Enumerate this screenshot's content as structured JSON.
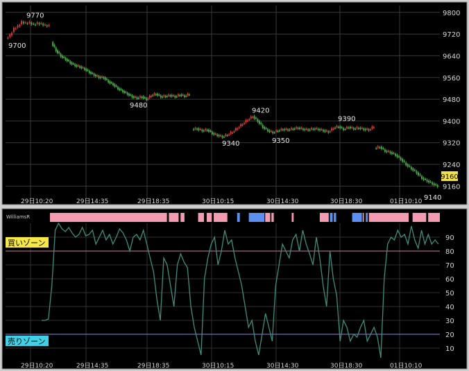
{
  "chart_data": [
    {
      "type": "candlestick",
      "y_ticks": [
        "9800",
        "9720",
        "9640",
        "9560",
        "9480",
        "9400",
        "9320",
        "9240",
        "9160"
      ],
      "ylim": [
        9115,
        9825
      ],
      "x_tick_labels": [
        "29日10:20",
        "29日14:35",
        "29日18:35",
        "30日10:15",
        "30日14:30",
        "30日18:30",
        "01日10:10"
      ],
      "last_price_label": "9160",
      "annotations": [
        {
          "text": "9770",
          "value": 9770
        },
        {
          "text": "9700",
          "value": 9700
        },
        {
          "text": "9480",
          "value": 9480
        },
        {
          "text": "9420",
          "value": 9420
        },
        {
          "text": "9390",
          "value": 9390
        },
        {
          "text": "9340",
          "value": 9340
        },
        {
          "text": "9350",
          "value": 9350
        },
        {
          "text": "9140",
          "value": 9140
        }
      ],
      "series": [
        {
          "segment": 1,
          "path": [
            9705,
            9715,
            9740,
            9748,
            9765,
            9760,
            9762,
            9755,
            9760,
            9758,
            9752,
            9750
          ]
        },
        {
          "segment": 2,
          "path": [
            9690,
            9660,
            9640,
            9628,
            9615,
            9605,
            9600,
            9592,
            9580,
            9570,
            9562,
            9560,
            9545,
            9535,
            9520,
            9510,
            9500,
            9490,
            9485,
            9490,
            9480,
            9495,
            9500,
            9490,
            9492,
            9495,
            9490,
            9497,
            9492,
            9500
          ]
        },
        {
          "segment": 3,
          "path": [
            9370,
            9372,
            9365,
            9368,
            9355,
            9348,
            9342,
            9350,
            9360,
            9375,
            9390,
            9405,
            9418,
            9400,
            9378,
            9365,
            9358,
            9365,
            9370,
            9368,
            9372,
            9375,
            9370,
            9368,
            9372,
            9370,
            9365,
            9360,
            9375,
            9380,
            9370,
            9378,
            9372,
            9375,
            9370,
            9368,
            9380
          ]
        },
        {
          "segment": 4,
          "path": [
            9300,
            9305,
            9290,
            9285,
            9275,
            9260,
            9240,
            9225,
            9210,
            9190,
            9180,
            9170,
            9160
          ]
        }
      ]
    },
    {
      "type": "line",
      "indicator_label": "WilliamsR",
      "y_ticks": [
        "90",
        "80",
        "70",
        "60",
        "50",
        "40",
        "30",
        "20",
        "10"
      ],
      "ylim": [
        0,
        100
      ],
      "buy_zone_label": "買いゾーン",
      "sell_zone_label": "売りゾーン",
      "buy_zone_value": 80,
      "sell_zone_value": 20,
      "series": [
        {
          "values": [
            30,
            30,
            31,
            55,
            95,
            100,
            96,
            94,
            97,
            93,
            90,
            92,
            97,
            91,
            92,
            95,
            85,
            90,
            95,
            88,
            92,
            85,
            90,
            96,
            93,
            88,
            80,
            90,
            92,
            88,
            95,
            85,
            75,
            65,
            45,
            30,
            75,
            70,
            55,
            40,
            70,
            78,
            72,
            68,
            40,
            25,
            15,
            5,
            60,
            75,
            85,
            90,
            70,
            80,
            95,
            85,
            88,
            75,
            65,
            55,
            40,
            25,
            30,
            15,
            5,
            20,
            35,
            25,
            15,
            55,
            70,
            85,
            80,
            75,
            88,
            92,
            80,
            95,
            85,
            78,
            70,
            90,
            75,
            55,
            40,
            80,
            60,
            48,
            15,
            30,
            25,
            15,
            20,
            18,
            25,
            30,
            15,
            20,
            25,
            18,
            3,
            60,
            85,
            90,
            88,
            95,
            90,
            92,
            85,
            98,
            88,
            82,
            95,
            85,
            92,
            85,
            88,
            85
          ]
        }
      ],
      "zone_bar": [
        {
          "color": "#f39bb0",
          "from": 0,
          "to": 0.3
        },
        {
          "color": "#f39bb0",
          "from": 0.305,
          "to": 0.33
        },
        {
          "color": "#f39bb0",
          "from": 0.335,
          "to": 0.345
        },
        {
          "color": "#f39bb0",
          "from": 0.38,
          "to": 0.395
        },
        {
          "color": "#f39bb0",
          "from": 0.402,
          "to": 0.415
        },
        {
          "color": "#f39bb0",
          "from": 0.42,
          "to": 0.455
        },
        {
          "color": "#5b8ff0",
          "from": 0.48,
          "to": 0.487
        },
        {
          "color": "#5b8ff0",
          "from": 0.51,
          "to": 0.55
        },
        {
          "color": "#f39bb0",
          "from": 0.552,
          "to": 0.565
        },
        {
          "color": "#f39bb0",
          "from": 0.568,
          "to": 0.574
        },
        {
          "color": "#f39bb0",
          "from": 0.62,
          "to": 0.625
        },
        {
          "color": "#f39bb0",
          "from": 0.692,
          "to": 0.715
        },
        {
          "color": "#5b8ff0",
          "from": 0.718,
          "to": 0.725
        },
        {
          "color": "#5b8ff0",
          "from": 0.728,
          "to": 0.734
        },
        {
          "color": "#5b8ff0",
          "from": 0.775,
          "to": 0.8
        },
        {
          "color": "#f39bb0",
          "from": 0.802,
          "to": 0.805
        },
        {
          "color": "#5b8ff0",
          "from": 0.81,
          "to": 0.815
        },
        {
          "color": "#f39bb0",
          "from": 0.818,
          "to": 0.92
        },
        {
          "color": "#f39bb0",
          "from": 0.93,
          "to": 0.965
        },
        {
          "color": "#f39bb0",
          "from": 0.97,
          "to": 1.0
        }
      ]
    }
  ]
}
